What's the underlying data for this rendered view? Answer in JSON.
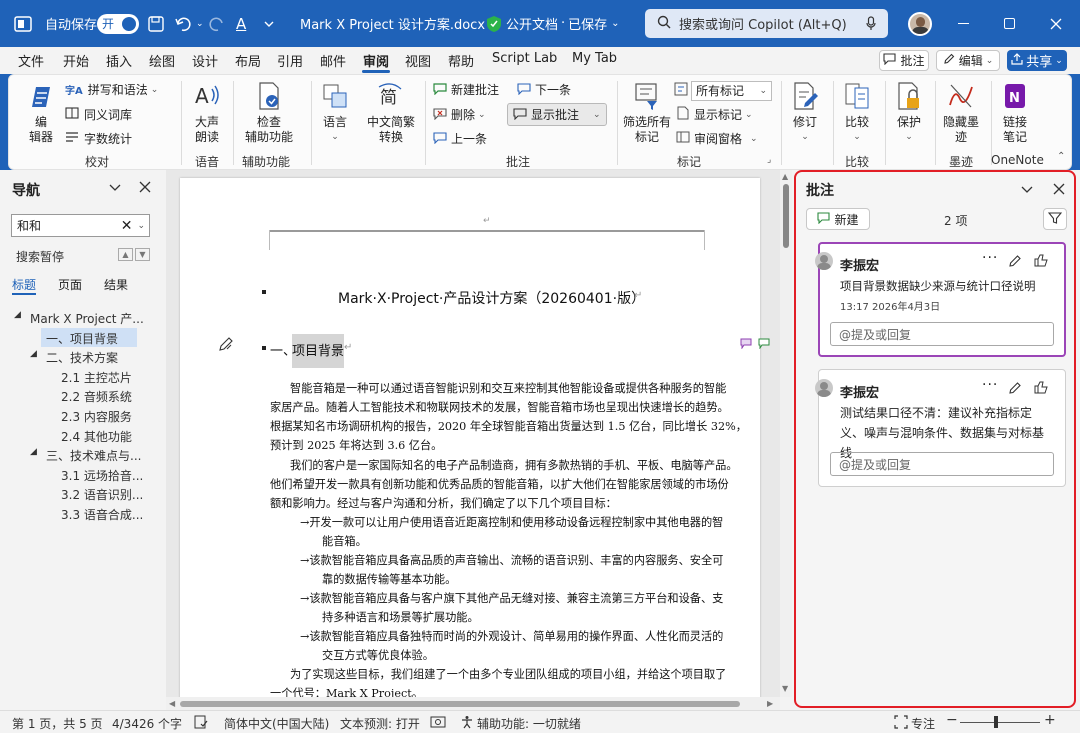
{
  "titlebar": {
    "autosave_label": "自动保存",
    "autosave_state": "开",
    "doc_title": "Mark X Project 设计方案.docx",
    "sensitivity": "公开文档",
    "save_state": "已保存",
    "search_placeholder": "搜索或询问 Copilot (Alt+Q)",
    "accent": "#1f62b8"
  },
  "menu": {
    "tabs": [
      "文件",
      "开始",
      "插入",
      "绘图",
      "设计",
      "布局",
      "引用",
      "邮件",
      "审阅",
      "视图",
      "帮助",
      "Script Lab",
      "My Tab"
    ],
    "active": "审阅",
    "comment_btn": "批注",
    "edit_btn": "编辑",
    "share_btn": "共享"
  },
  "ribbon": {
    "editor": "编\n辑器",
    "spelling": "拼写和语法",
    "thesaurus": "同义词库",
    "wordcount": "字数统计",
    "group_proofing": "校对",
    "read_aloud": "大声\n朗读",
    "group_speech": "语音",
    "check_access": "检查\n辅助功能",
    "group_access": "辅助功能",
    "language": "语言",
    "convert": "中文简繁\n转换",
    "new_comment": "新建批注",
    "delete": "删除",
    "previous": "上一条",
    "next": "下一条",
    "show_comments": "显示批注",
    "group_comments": "批注",
    "filter_markup": "筛选所有\n标记",
    "all_markup": "所有标记",
    "show_markup": "显示标记",
    "review_pane": "审阅窗格",
    "group_tracking": "标记",
    "track": "修订",
    "compare": "比较",
    "group_compare": "比较",
    "protect": "保护",
    "hide_ink": "隐藏墨\n迹",
    "group_ink": "墨迹",
    "linked_notes": "链接\n笔记",
    "group_onenote": "OneNote"
  },
  "nav": {
    "title": "导航",
    "search_value": "和和",
    "search_paused": "搜索暂停",
    "tabs": [
      "标题",
      "页面",
      "结果"
    ],
    "active_tab": "标题",
    "items": [
      {
        "label": "Mark X Project 产...",
        "level": 0,
        "selected": false
      },
      {
        "label": "一、项目背景",
        "level": 1,
        "selected": true
      },
      {
        "label": "二、技术方案",
        "level": 1,
        "selected": false
      },
      {
        "label": "2.1 主控芯片",
        "level": 2,
        "selected": false
      },
      {
        "label": "2.2 音频系统",
        "level": 2,
        "selected": false
      },
      {
        "label": "2.3 内容服务",
        "level": 2,
        "selected": false
      },
      {
        "label": "2.4 其他功能",
        "level": 2,
        "selected": false
      },
      {
        "label": "三、技术难点与...",
        "level": 1,
        "selected": false
      },
      {
        "label": "3.1 远场拾音...",
        "level": 2,
        "selected": false
      },
      {
        "label": "3.2 语音识别...",
        "level": 2,
        "selected": false
      },
      {
        "label": "3.3 语音合成...",
        "level": 2,
        "selected": false
      }
    ]
  },
  "document": {
    "title": "Mark·X·Project·产品设计方案（20260401·版）",
    "heading": "一、项目背景",
    "lines": [
      "智能音箱是一种可以通过语音智能识别和交互来控制其他智能设备或提供各种服务的智能",
      "家居产品。随着人工智能技术和物联网技术的发展，智能音箱市场也呈现出快速增长的趋势。",
      "根据某知名市场调研机构的报告，2020 年全球智能音箱出货量达到 1.5 亿台，同比增长 32%，",
      "预计到 2025 年将达到 3.6 亿台。",
      "我们的客户是一家国际知名的电子产品制造商，拥有多款热销的手机、平板、电脑等产品。",
      "他们希望开发一款具有创新功能和优秀品质的智能音箱，以扩大他们在智能家居领域的市场份",
      "额和影响力。经过与客户沟通和分析，我们确定了以下几个项目目标：",
      "→开发一款可以让用户使用语音近距离控制和使用移动设备远程控制家中其他电器的智",
      "能音箱。",
      "→该款智能音箱应具备高品质的声音输出、流畅的语音识别、丰富的内容服务、安全可",
      "靠的数据传输等基本功能。",
      "→该款智能音箱应具备与客户旗下其他产品无缝对接、兼容主流第三方平台和设备、支",
      "持多种语言和场景等扩展功能。",
      "→该款智能音箱应具备独特而时尚的外观设计、简单易用的操作界面、人性化而灵活的",
      "交互方式等优良体验。",
      "为了实现这些目标，我们组建了一个由多个专业团队组成的项目小组，并给这个项目取了",
      "一个代号：Mark X Project。"
    ]
  },
  "comments": {
    "title": "批注",
    "new_btn": "新建",
    "count": "2 项",
    "items": [
      {
        "author": "李振宏",
        "text": "项目背景数据缺少来源与统计口径说明",
        "time": "13:17 2026年4月3日",
        "reply_placeholder": "@提及或回复"
      },
      {
        "author": "李振宏",
        "text": "测试结果口径不清：建议补充指标定义、噪声与混响条件、数据集与对标基线",
        "reply_placeholder": "@提及或回复"
      }
    ]
  },
  "status": {
    "page": "第 1 页，共 5 页",
    "words": "4/3426 个字",
    "language": "简体中文(中国大陆)",
    "prediction": "文本预测: 打开",
    "accessibility": "辅助功能: 一切就绪",
    "focus": "专注"
  }
}
